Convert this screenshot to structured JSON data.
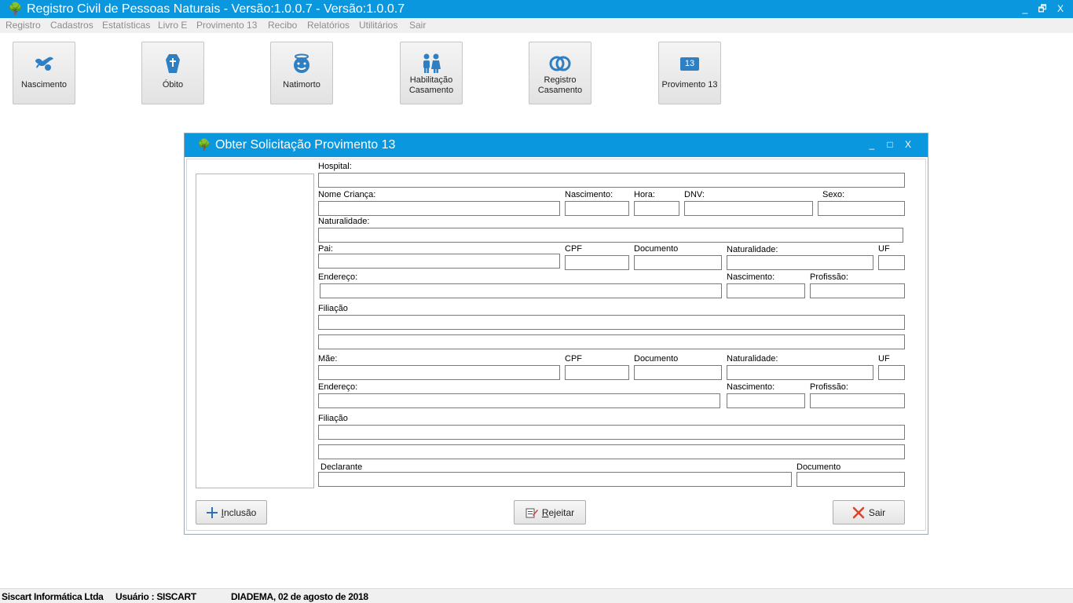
{
  "window": {
    "title": "Registro Civil de Pessoas Naturais - Versão:1.0.0.7 - Versão:1.0.0.7",
    "minimize": "_",
    "restore": "🗗",
    "close": "X"
  },
  "menu": [
    "Registro",
    "Cadastros",
    "Estatísticas",
    "Livro E",
    "Provimento 13",
    "Recibo",
    "Relatórios",
    "Utilitários",
    "Sair"
  ],
  "toolbar": {
    "nascimento": "Nascimento",
    "obito": "Óbito",
    "natimorto": "Natimorto",
    "habilitacao_1": "Habilitação",
    "habilitacao_2": "Casamento",
    "registro_1": "Registro",
    "registro_2": "Casamento",
    "provimento": "Provimento 13",
    "provimento_badge": "13"
  },
  "dialog": {
    "title": "Obter Solicitação Provimento 13",
    "minimize": "_",
    "maximize": "□",
    "close": "X"
  },
  "form": {
    "hospital": "Hospital:",
    "nome_crianca": "Nome Criança:",
    "nascimento": "Nascimento:",
    "hora": "Hora:",
    "dnv": "DNV:",
    "sexo": "Sexo:",
    "naturalidade": "Naturalidade:",
    "pai": "Pai:",
    "cpf": "CPF",
    "documento": "Documento",
    "naturalidade2": "Naturalidade:",
    "uf": "UF",
    "endereco": "Endereço:",
    "nascimento2": "Nascimento:",
    "profissao": "Profissão:",
    "filiacao": "Filiação",
    "mae": "Mãe:",
    "declarante": "Declarante",
    "documento2": "Documento"
  },
  "buttons": {
    "inclusao_first": "I",
    "inclusao_rest": "nclusão",
    "rejeitar_first": "R",
    "rejeitar_rest": "ejeitar",
    "sair": "Sair"
  },
  "status": {
    "company": "Siscart Informática Ltda",
    "user": "Usuário : SISCART",
    "place_date": "DIADEMA,  02 de agosto de 2018"
  }
}
